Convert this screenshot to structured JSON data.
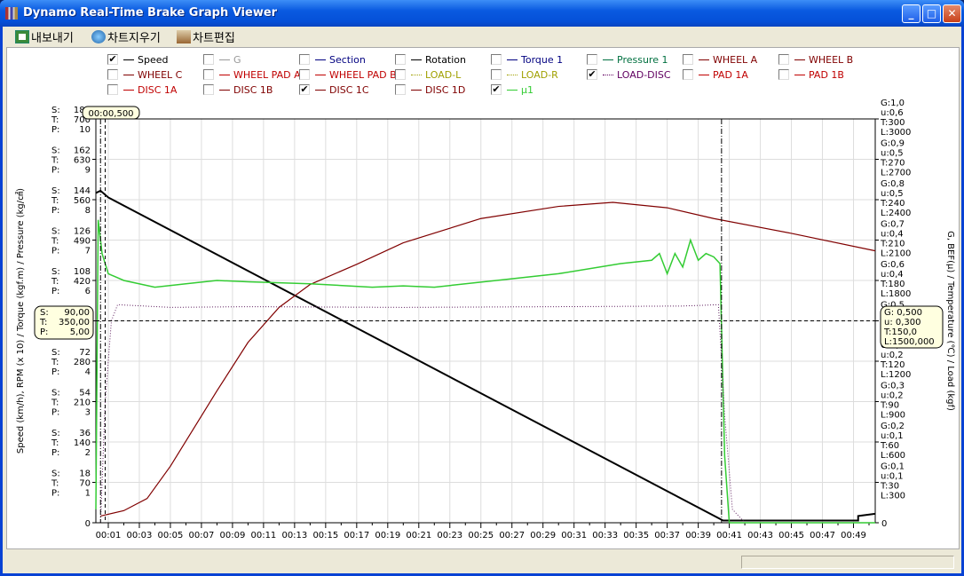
{
  "window": {
    "title": "Dynamo Real-Time Brake Graph Viewer",
    "minimize": "_",
    "maximize": "□",
    "close": "✕"
  },
  "toolbar": {
    "export": "내보내기",
    "clear_chart": "차트지우기",
    "edit_chart": "차트편집"
  },
  "legend": [
    {
      "label": "Speed",
      "checked": true,
      "color": "#000000",
      "style": "solid"
    },
    {
      "label": "G",
      "checked": false,
      "color": "#999999",
      "style": "solid"
    },
    {
      "label": "Section",
      "checked": false,
      "color": "#000080",
      "style": "solid"
    },
    {
      "label": "Rotation",
      "checked": false,
      "color": "#000000",
      "style": "solid"
    },
    {
      "label": "Torque 1",
      "checked": false,
      "color": "#000080",
      "style": "solid"
    },
    {
      "label": "Pressure 1",
      "checked": false,
      "color": "#007040",
      "style": "solid"
    },
    {
      "label": "WHEEL A",
      "checked": false,
      "color": "#800000",
      "style": "solid"
    },
    {
      "label": "WHEEL B",
      "checked": false,
      "color": "#800000",
      "style": "solid"
    },
    {
      "label": "WHEEL C",
      "checked": false,
      "color": "#800000",
      "style": "solid"
    },
    {
      "label": "WHEEL PAD A",
      "checked": false,
      "color": "#c00000",
      "style": "solid"
    },
    {
      "label": "WHEEL PAD B",
      "checked": false,
      "color": "#c00000",
      "style": "solid"
    },
    {
      "label": "LOAD-L",
      "checked": false,
      "color": "#a0a000",
      "style": "dotted"
    },
    {
      "label": "LOAD-R",
      "checked": false,
      "color": "#a0a000",
      "style": "dotted"
    },
    {
      "label": "LOAD-DISC",
      "checked": true,
      "color": "#600060",
      "style": "dotted"
    },
    {
      "label": "PAD 1A",
      "checked": false,
      "color": "#c00000",
      "style": "solid"
    },
    {
      "label": "PAD 1B",
      "checked": false,
      "color": "#c00000",
      "style": "solid"
    },
    {
      "label": "DISC 1A",
      "checked": false,
      "color": "#c00000",
      "style": "solid"
    },
    {
      "label": "DISC 1B",
      "checked": false,
      "color": "#800000",
      "style": "solid"
    },
    {
      "label": "DISC 1C",
      "checked": true,
      "color": "#800000",
      "style": "solid"
    },
    {
      "label": "DISC 1D",
      "checked": false,
      "color": "#800000",
      "style": "solid"
    },
    {
      "label": "μ1",
      "checked": true,
      "color": "#33cc33",
      "style": "solid"
    }
  ],
  "chart_data": {
    "type": "line",
    "ylabel_left": "Speed (km/h), RPM (x 10) / Torque (kgf.m) / Pressure (kg/㎠)",
    "ylabel_right": "G, BEF(μ) / Temperature (℃) / Load (kgf)",
    "xlim": [
      0.2,
      50.4
    ],
    "x_ticks": [
      "00:01",
      "00:03",
      "00:05",
      "00:07",
      "00:09",
      "00:11",
      "00:13",
      "00:15",
      "00:17",
      "00:19",
      "00:21",
      "00:23",
      "00:25",
      "00:27",
      "00:29",
      "00:31",
      "00:33",
      "00:35",
      "00:37",
      "00:39",
      "00:41",
      "00:43",
      "00:45",
      "00:47",
      "00:49"
    ],
    "left_ticks": {
      "S": [
        0,
        18,
        36,
        54,
        72,
        90,
        108,
        126,
        144,
        162,
        180
      ],
      "T": [
        0,
        70,
        140,
        210,
        280,
        350,
        420,
        490,
        560,
        630,
        700
      ],
      "P": [
        0,
        1,
        2,
        3,
        4,
        5,
        6,
        7,
        8,
        9,
        10
      ]
    },
    "right_ticks": {
      "G": [
        "0",
        "0,1",
        "0,2",
        "0,3",
        "0,4",
        "0,5",
        "0,6",
        "0,7",
        "0,8",
        "0,9",
        "1,0"
      ],
      "u": [
        "0",
        "0,1",
        "0,1",
        "0,2",
        "0,2",
        "0,3",
        "0,4",
        "0,4",
        "0,5",
        "0,5",
        "0,6"
      ],
      "T": [
        "0",
        "30",
        "60",
        "90",
        "120",
        "150",
        "180",
        "210",
        "240",
        "270",
        "300"
      ],
      "L": [
        "0",
        "300",
        "600",
        "900",
        "1200",
        "1500",
        "1800",
        "2100",
        "2400",
        "2700",
        "3000"
      ]
    },
    "grid": true,
    "series": [
      {
        "name": "Speed",
        "axis": "S",
        "ylim": [
          0,
          180
        ],
        "color": "#000000",
        "width": 2,
        "x": [
          0.2,
          0.5,
          1,
          40.6,
          49.3,
          49.3,
          50.4
        ],
        "y": [
          147,
          148,
          145,
          1,
          1,
          3,
          4
        ]
      },
      {
        "name": "DISC 1C",
        "axis": "T",
        "ylim": [
          0,
          300
        ],
        "color": "#800000",
        "width": 1.2,
        "x": [
          0.5,
          2,
          3.5,
          5,
          6.5,
          8,
          10,
          12,
          14,
          17,
          20,
          25,
          30,
          33.5,
          37,
          40,
          45,
          50.4
        ],
        "y": [
          5,
          9,
          18,
          42,
          70,
          98,
          134,
          160,
          177,
          192,
          208,
          226,
          235,
          238,
          234,
          226,
          215,
          202
        ]
      },
      {
        "name": "μ1",
        "axis": "u",
        "ylim": [
          0,
          0.6
        ],
        "color": "#33cc33",
        "width": 1.5,
        "x": [
          0.2,
          0.35,
          0.6,
          1,
          2,
          4,
          6,
          8,
          10,
          14,
          18,
          20,
          22,
          26,
          30,
          34,
          36,
          36.5,
          37,
          37.5,
          38,
          38.5,
          39,
          39.5,
          40,
          40.4,
          40.7,
          41,
          50.4
        ],
        "y": [
          0.02,
          0.45,
          0.4,
          0.37,
          0.36,
          0.35,
          0.355,
          0.36,
          0.358,
          0.355,
          0.35,
          0.352,
          0.35,
          0.36,
          0.37,
          0.385,
          0.39,
          0.4,
          0.37,
          0.4,
          0.38,
          0.42,
          0.39,
          0.4,
          0.395,
          0.385,
          0.1,
          0,
          0
        ]
      },
      {
        "name": "LOAD-DISC",
        "axis": "L",
        "ylim": [
          0,
          3000
        ],
        "color": "#602060",
        "width": 1,
        "dotted": true,
        "x": [
          0.5,
          0.8,
          1.2,
          1.6,
          5,
          10,
          20,
          30,
          38,
          40.3,
          40.7,
          41.2,
          42
        ],
        "y": [
          0,
          900,
          1500,
          1620,
          1600,
          1605,
          1600,
          1605,
          1610,
          1620,
          800,
          100,
          0
        ]
      }
    ],
    "cursor": {
      "time": "00:00,500",
      "left": {
        "S": "90,00",
        "T": "350,00",
        "P": "5,00"
      },
      "right": {
        "G": "0,500",
        "u": "0,300",
        "T": "150,0",
        "L": "1500,000"
      },
      "level_S": 90,
      "x": 0.5,
      "x2": 0.8,
      "x3": 40.5
    }
  }
}
